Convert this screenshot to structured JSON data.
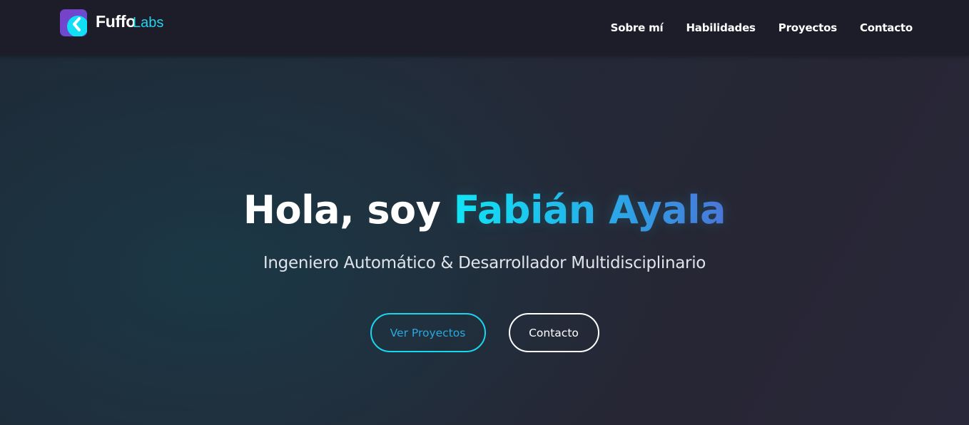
{
  "navbar": {
    "logo": {
      "brand": "Fuffo",
      "brand_sub": "Labs",
      "icon": "chevron-left-logo-icon"
    },
    "links": [
      {
        "label": "Sobre mí"
      },
      {
        "label": "Habilidades"
      },
      {
        "label": "Proyectos"
      },
      {
        "label": "Contacto"
      }
    ]
  },
  "hero": {
    "greeting": "Hola, soy ",
    "name": "Fabián Ayala",
    "subtitle": "Ingeniero Automático & Desarrollador Multidisciplinario",
    "primary_button": "Ver Proyectos",
    "secondary_button": "Contacto"
  },
  "colors": {
    "accent": "#22d3ee",
    "accent_gradient_end": "#4f6fd8",
    "navbar_bg": "#1d1d2a",
    "page_bg": "#252634"
  }
}
